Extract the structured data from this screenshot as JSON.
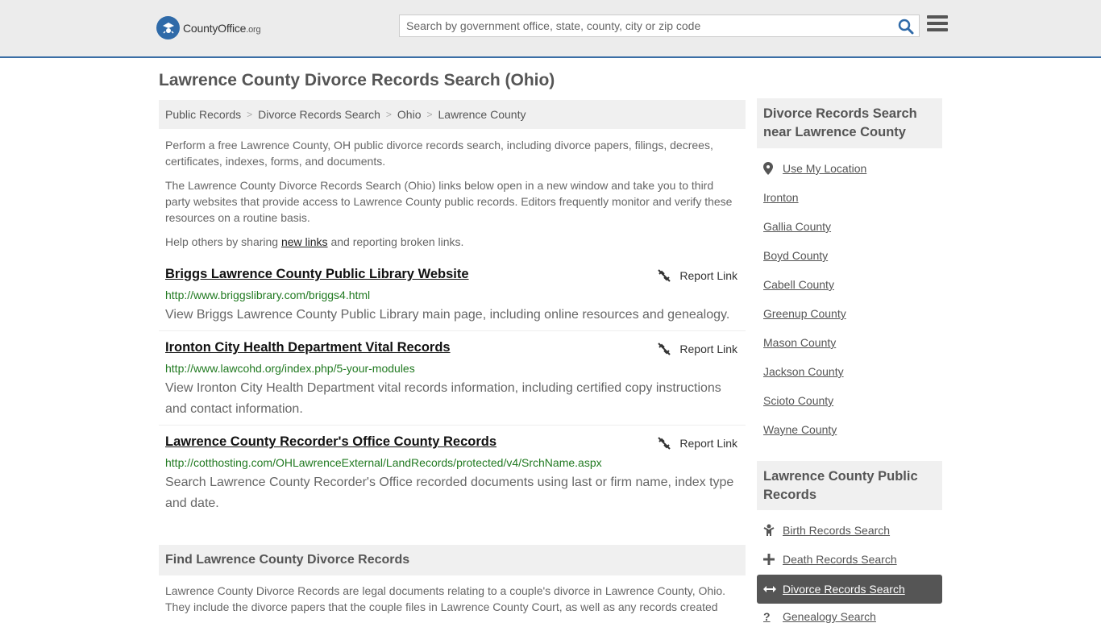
{
  "header": {
    "logo_main": "CountyOffice",
    "logo_tld": ".org",
    "search_placeholder": "Search by government office, state, county, city or zip code"
  },
  "page": {
    "title": "Lawrence County Divorce Records Search (Ohio)"
  },
  "breadcrumb": [
    "Public Records",
    "Divorce Records Search",
    "Ohio",
    "Lawrence County"
  ],
  "intro": {
    "p1": "Perform a free Lawrence County, OH public divorce records search, including divorce papers, filings, decrees, certificates, indexes, forms, and documents.",
    "p2": "The Lawrence County Divorce Records Search (Ohio) links below open in a new window and take you to third party websites that provide access to Lawrence County public records. Editors frequently monitor and verify these resources on a routine basis.",
    "p3_before": "Help others by sharing ",
    "p3_link": "new links",
    "p3_after": " and reporting broken links."
  },
  "report_label": "Report Link",
  "results": [
    {
      "title": "Briggs Lawrence County Public Library Website",
      "url": "http://www.briggslibrary.com/briggs4.html",
      "desc": "View Briggs Lawrence County Public Library main page, including online resources and genealogy."
    },
    {
      "title": "Ironton City Health Department Vital Records",
      "url": "http://www.lawcohd.org/index.php/5-your-modules",
      "desc": "View Ironton City Health Department vital records information, including certified copy instructions and contact information."
    },
    {
      "title": "Lawrence County Recorder's Office County Records",
      "url": "http://cotthosting.com/OHLawrenceExternal/LandRecords/protected/v4/SrchName.aspx",
      "desc": "Search Lawrence County Recorder's Office recorded documents using last or firm name, index type and date."
    }
  ],
  "find": {
    "heading": "Find Lawrence County Divorce Records",
    "text": "Lawrence County Divorce Records are legal documents relating to a couple's divorce in Lawrence County, Ohio. They include the divorce papers that the couple files in Lawrence County Court, as well as any records created"
  },
  "sidebar": {
    "nearby_title": "Divorce Records Search near Lawrence County",
    "use_location": "Use My Location",
    "nearby": [
      "Ironton",
      "Gallia County",
      "Boyd County",
      "Cabell County",
      "Greenup County",
      "Mason County",
      "Jackson County",
      "Scioto County",
      "Wayne County"
    ],
    "public_title": "Lawrence County Public Records",
    "public_links": [
      {
        "label": "Birth Records Search",
        "icon": "child-icon"
      },
      {
        "label": "Death Records Search",
        "icon": "plus-icon"
      },
      {
        "label": "Divorce Records Search",
        "icon": "arrows-icon"
      },
      {
        "label": "Genealogy Search",
        "icon": "question-icon"
      }
    ]
  },
  "colors": {
    "header_bg": "#ececec",
    "accent": "#3a6ea5",
    "url_green": "#217a21",
    "active_bg": "#555555"
  }
}
